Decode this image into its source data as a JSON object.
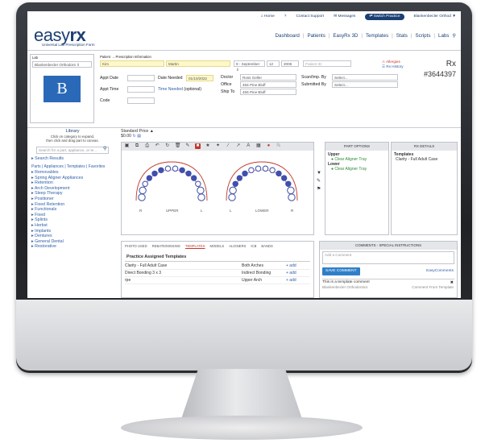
{
  "topnav": {
    "home": "Home",
    "help": "?",
    "contact": "Contact Support",
    "messages": "Messages",
    "switch": "Switch Practice",
    "practice": "Blankenbecler Orthod"
  },
  "brand": {
    "logo_light": "easy",
    "logo_bold": "rx",
    "subtitle": "Universal Lab Prescription Form"
  },
  "mainnav": [
    "Dashboard",
    "Patients",
    "EasyRx 3D",
    "Templates",
    "Stats",
    "Scripts",
    "Labs"
  ],
  "lab": {
    "label": "Lab",
    "value": "Blankenbecler Orthodont",
    "avatar": "B"
  },
  "patient": {
    "header": "Patient → Prescription Information",
    "first": "Kim",
    "last": "Martin",
    "birth_month": "9 - September",
    "birth_day": "12",
    "birth_year": "2006",
    "patient_id_placeholder": "Patient ID",
    "allergies": "Allergies",
    "rx_history": "Rx History"
  },
  "rx": {
    "label": "Rx",
    "number": "#3644397"
  },
  "appt": {
    "date_label": "Appt Date",
    "time_label": "Appt Time",
    "code_label": "Code",
    "needed_label": "Date Needed",
    "needed_value": "01/10/2022",
    "time_needed": "Time Needed",
    "optional": "(optional)"
  },
  "doctor": {
    "doctor_label": "Doctor",
    "doctor_value": "Ross Geller",
    "office_label": "Office",
    "office_value": "456 Pine Bluff",
    "ship_label": "Ship To",
    "ship_value": "456 Pine Bluff",
    "scan_label": "Scan/Imp. By",
    "scan_value": "Select...",
    "submitted_label": "Submitted By",
    "submitted_value": "Select..."
  },
  "library": {
    "title": "Library",
    "hint1": "Click on category to expand,",
    "hint2": "then click and drag part to canvas.",
    "search_placeholder": "Search for a part, appliance, or te...",
    "search_results": "Search Results",
    "parts_line": "Parts | Appliances | Templates | Favorites",
    "categories": [
      "Removables",
      "Spring Aligner Appliances",
      "Retention",
      "Arch Development",
      "Sleep Therapy",
      "Positioner",
      "Fixed Retention",
      "Functionals",
      "Fixed",
      "Splints",
      "Herbst",
      "Implants",
      "Dentures",
      "General Dental",
      "Restorative"
    ]
  },
  "price": {
    "label": "Standard Price",
    "value": "$0.00"
  },
  "canvas": {
    "upper": "UPPER",
    "lower": "LOWER",
    "r1": "R",
    "l1": "L",
    "l2": "L",
    "r2": "R"
  },
  "part_options": {
    "title": "Part Options",
    "upper": "Upper",
    "upper_item": "Clear Aligner Tray",
    "lower": "Lower",
    "lower_item": "Clear Aligner Tray"
  },
  "rx_details": {
    "title": "Rx Details",
    "templates": "Templates",
    "item": "Clarity - Full Adult Case"
  },
  "bottom_tabs": [
    "Photo Used",
    "Rebate/Missing",
    "Templates",
    "Models",
    "Aligners",
    "ICB",
    "Bands"
  ],
  "templates_panel": {
    "title": "Practice Assigned Templates",
    "rows": [
      {
        "name": "Clarity - Full Adult Case",
        "arch": "Both Arches",
        "action": "+ add"
      },
      {
        "name": "Direct Bonding 3 x 3",
        "arch": "Indirect Bonding",
        "action": "+ add"
      },
      {
        "name": "rpe",
        "arch": "Upper Arch",
        "action": "+ add"
      }
    ]
  },
  "comments": {
    "title": "Comments - Special Instructions",
    "placeholder": "Add a Comment",
    "save": "SAVE COMMENT",
    "easy": "EasyComments",
    "c_text": "This is a template comment",
    "c_author": "Blankenbecler Orthodontics",
    "c_source": "Comment From Template"
  },
  "colors": {
    "brand": "#1b3f73",
    "accent": "#2f7fc8",
    "link": "#2f5ea8"
  }
}
